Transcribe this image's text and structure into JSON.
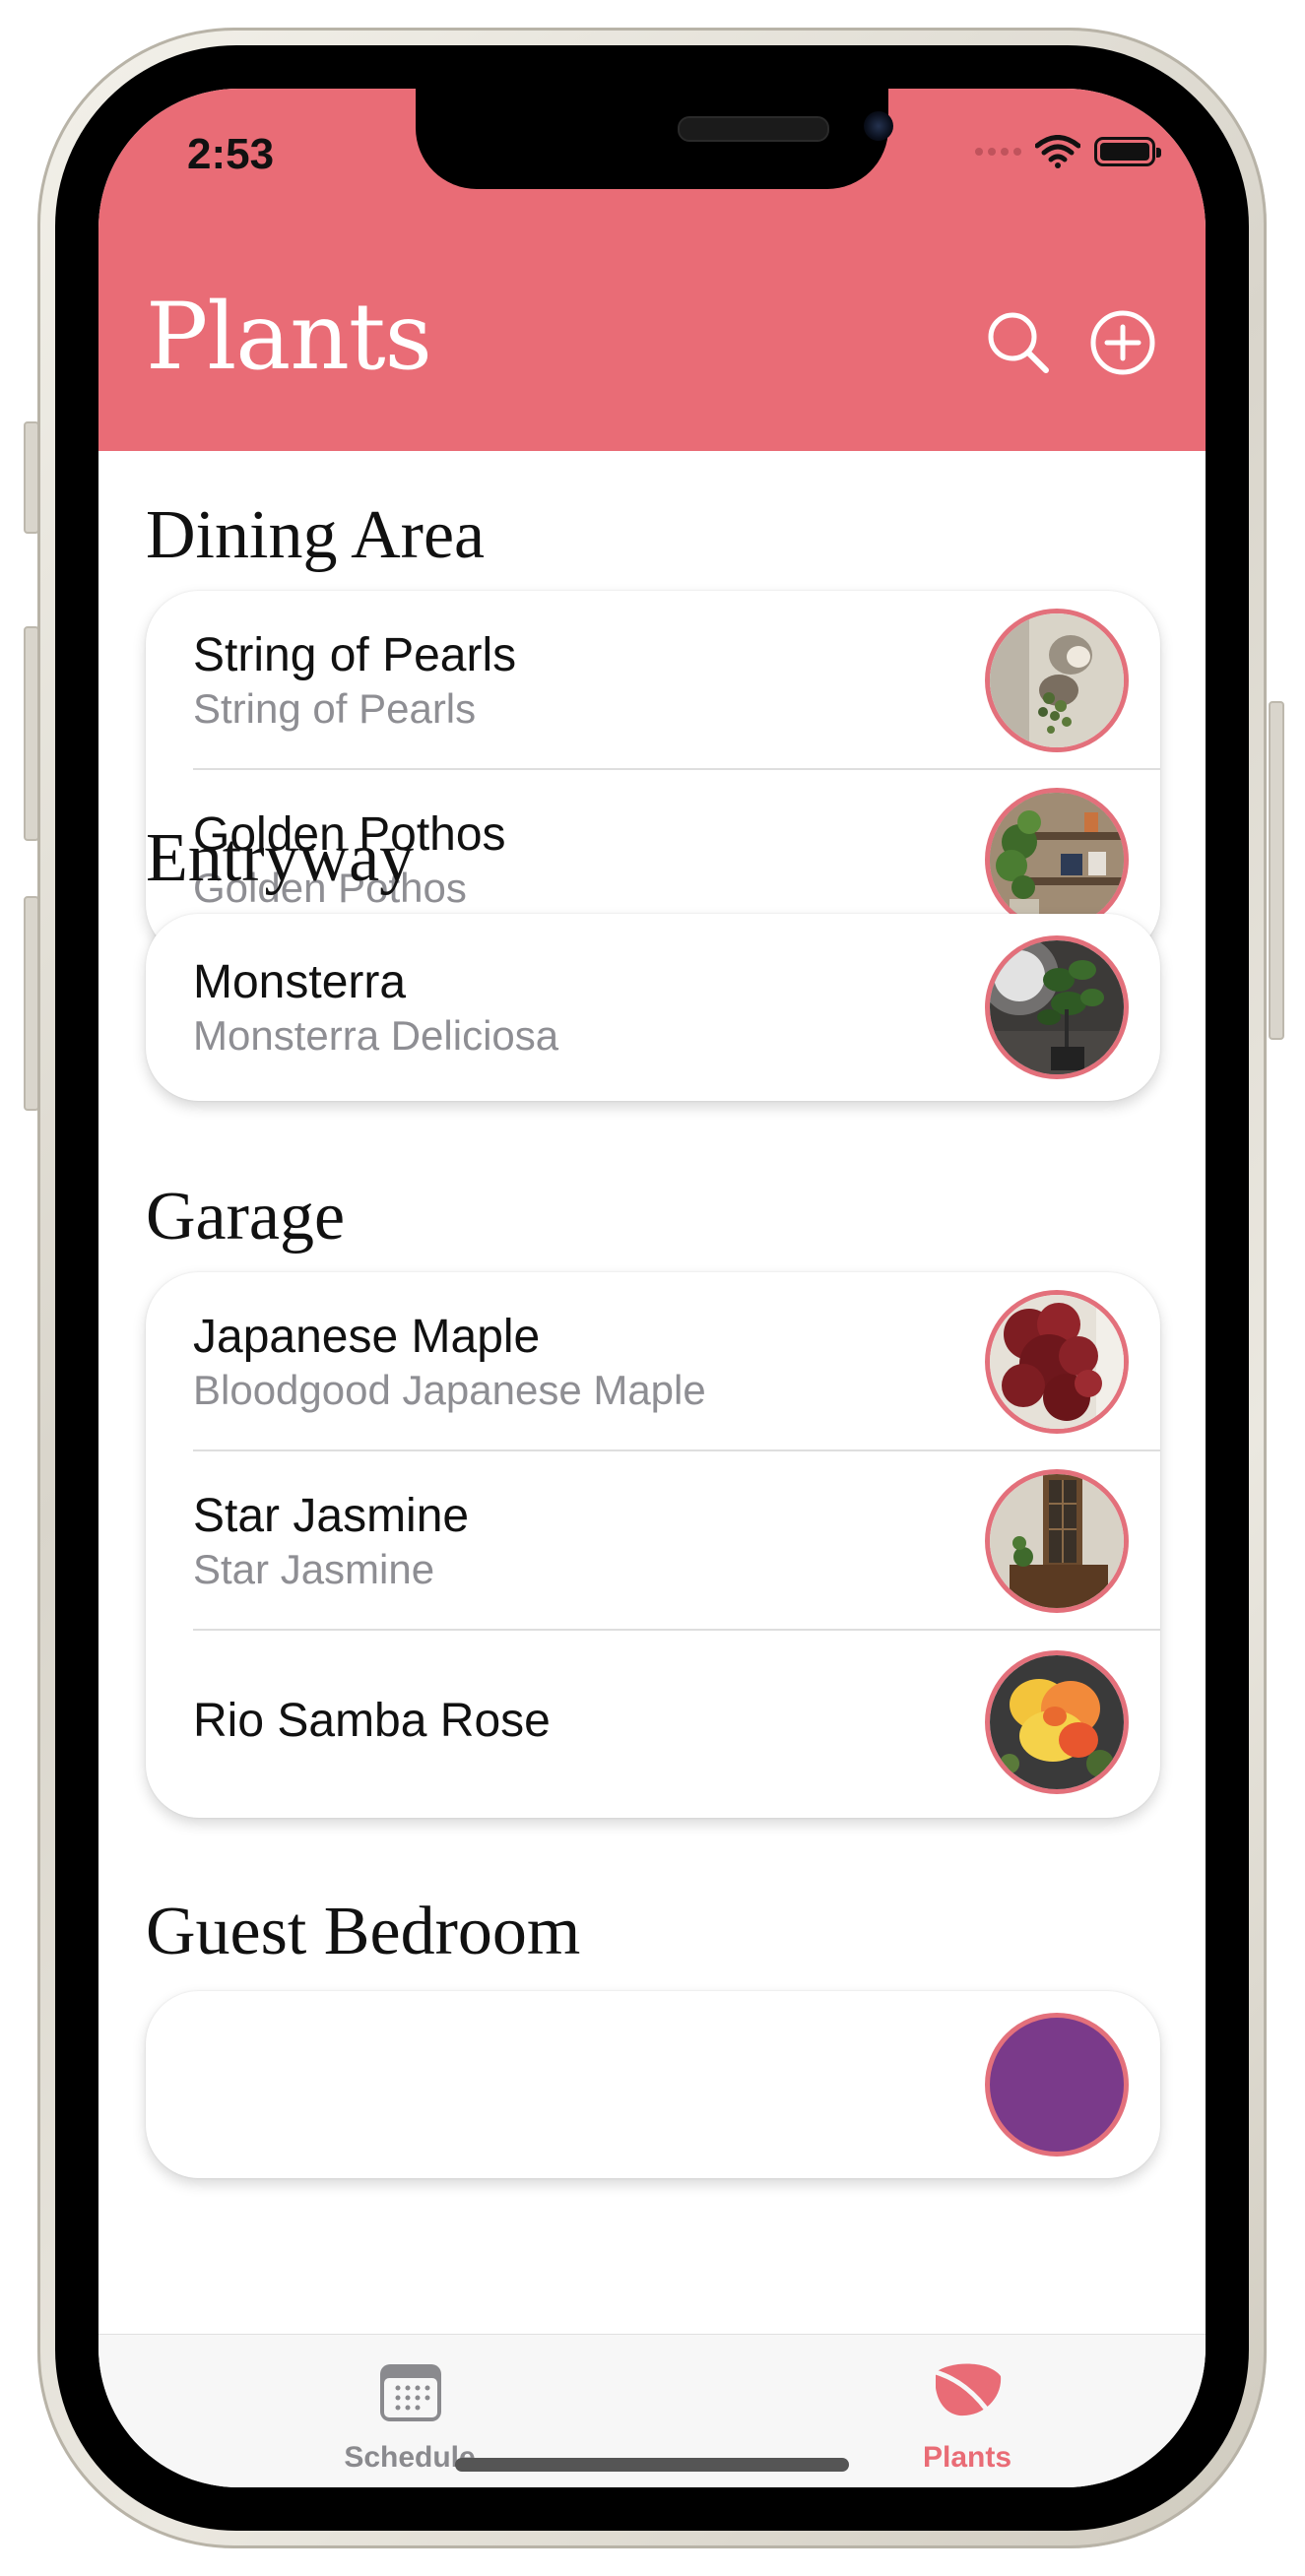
{
  "status_bar": {
    "time": "2:53"
  },
  "header": {
    "title": "Plants",
    "accent_color": "#e96c76"
  },
  "icons": {
    "search": "search-icon",
    "add": "plus-circle-icon"
  },
  "sections": [
    {
      "title": "Dining Area",
      "plants": [
        {
          "name": "String of Pearls",
          "scientific": "String of Pearls"
        },
        {
          "name": "Golden Pothos",
          "scientific": "Golden Pothos"
        }
      ]
    },
    {
      "title": "Entryway",
      "plants": [
        {
          "name": "Monsterra",
          "scientific": "Monsterra Deliciosa"
        }
      ]
    },
    {
      "title": "Garage",
      "plants": [
        {
          "name": "Japanese Maple",
          "scientific": "Bloodgood Japanese Maple"
        },
        {
          "name": "Star Jasmine",
          "scientific": "Star Jasmine"
        },
        {
          "name": "Rio Samba Rose",
          "scientific": ""
        }
      ]
    },
    {
      "title": "Guest Bedroom",
      "plants": []
    }
  ],
  "tabs": [
    {
      "label": "Schedule",
      "icon": "calendar-icon",
      "selected": false
    },
    {
      "label": "Plants",
      "icon": "leaf-icon",
      "selected": true
    }
  ],
  "colors": {
    "tab_inactive": "#8a8a8e",
    "tab_active": "#e96c76"
  }
}
